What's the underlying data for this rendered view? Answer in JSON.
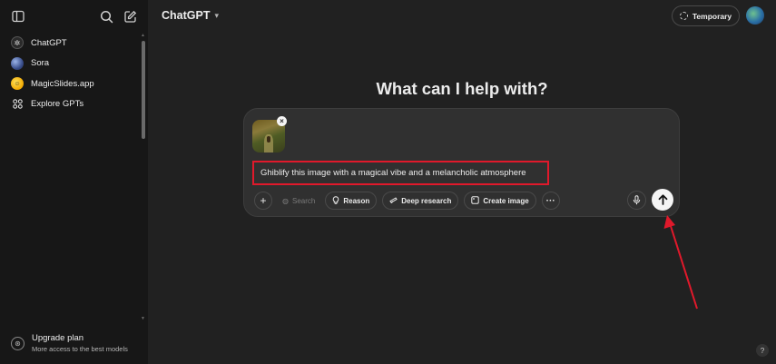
{
  "sidebar": {
    "items": [
      {
        "label": "ChatGPT",
        "icon": "chatgpt-logo-icon"
      },
      {
        "label": "Sora",
        "icon": "sora-icon"
      },
      {
        "label": "MagicSlides.app",
        "icon": "magicslides-icon"
      },
      {
        "label": "Explore GPTs",
        "icon": "grid-icon"
      }
    ],
    "upgrade": {
      "title": "Upgrade plan",
      "subtitle": "More access to the best models"
    }
  },
  "header": {
    "model": "ChatGPT",
    "temporary_label": "Temporary"
  },
  "main": {
    "headline": "What can I help with?",
    "prompt": "Ghiblify this image with a magical vibe and a melancholic atmosphere",
    "tools": {
      "search": "Search",
      "reason": "Reason",
      "deep_research": "Deep research",
      "create_image": "Create image"
    }
  },
  "help_label": "?",
  "colors": {
    "background": "#212121",
    "sidebar": "#171717",
    "composer": "#303030",
    "highlight": "#e0192b"
  }
}
